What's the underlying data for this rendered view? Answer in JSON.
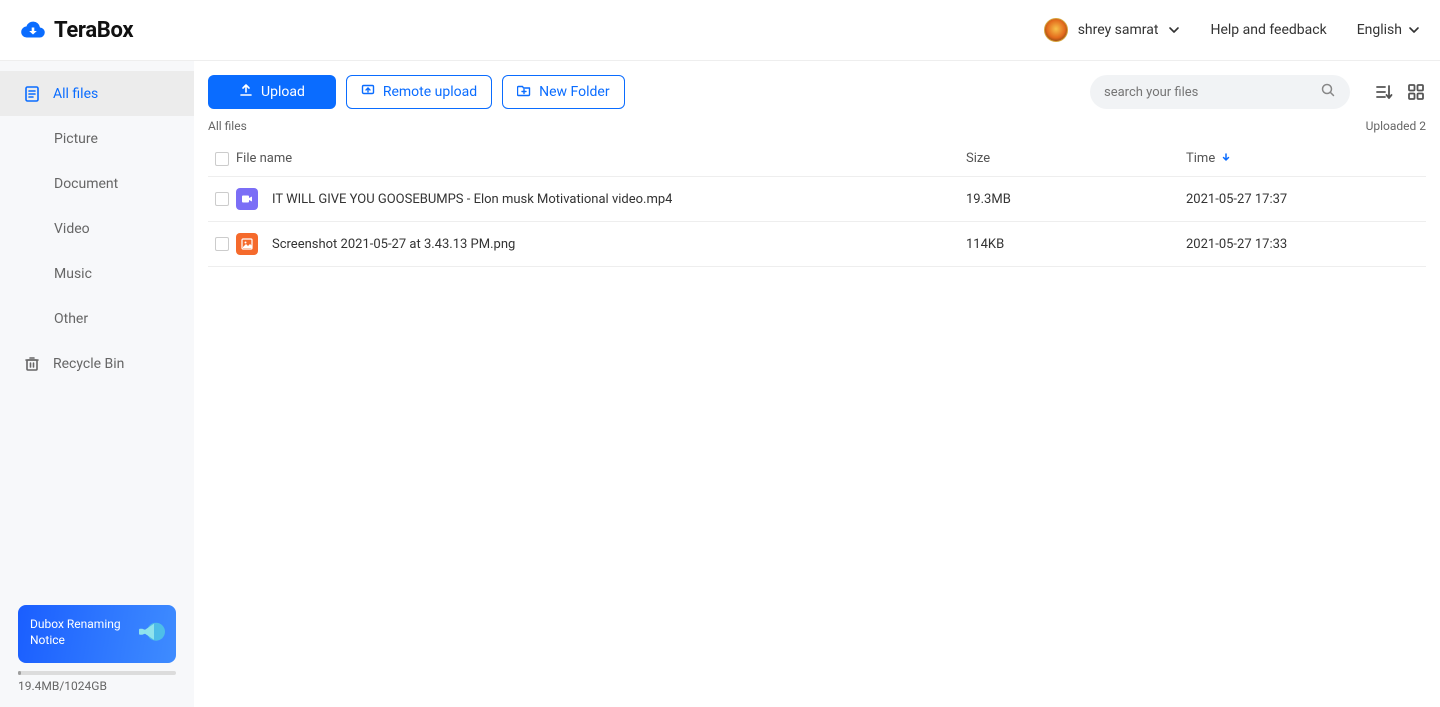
{
  "header": {
    "brand": "TeraBox",
    "user_name": "shrey samrat",
    "help_label": "Help and feedback",
    "language_label": "English"
  },
  "sidebar": {
    "items": [
      {
        "label": "All files",
        "icon": "file-icon",
        "active": true
      },
      {
        "label": "Picture",
        "indent": true
      },
      {
        "label": "Document",
        "indent": true
      },
      {
        "label": "Video",
        "indent": true
      },
      {
        "label": "Music",
        "indent": true
      },
      {
        "label": "Other",
        "indent": true
      },
      {
        "label": "Recycle Bin",
        "icon": "trash-icon"
      }
    ],
    "promo_text": "Dubox Renaming Notice",
    "storage_text": "19.4MB/1024GB"
  },
  "toolbar": {
    "upload_label": "Upload",
    "remote_upload_label": "Remote upload",
    "new_folder_label": "New Folder",
    "search_placeholder": "search your files"
  },
  "breadcrumb": {
    "path": "All files",
    "uploaded_label": "Uploaded 2"
  },
  "table": {
    "headers": {
      "name": "File name",
      "size": "Size",
      "time": "Time"
    },
    "rows": [
      {
        "icon": "video",
        "name": "IT WILL GIVE YOU GOOSEBUMPS - Elon musk Motivational video.mp4",
        "size": "19.3MB",
        "time": "2021-05-27 17:37"
      },
      {
        "icon": "image",
        "name": "Screenshot 2021-05-27 at 3.43.13 PM.png",
        "size": "114KB",
        "time": "2021-05-27 17:33"
      }
    ]
  }
}
